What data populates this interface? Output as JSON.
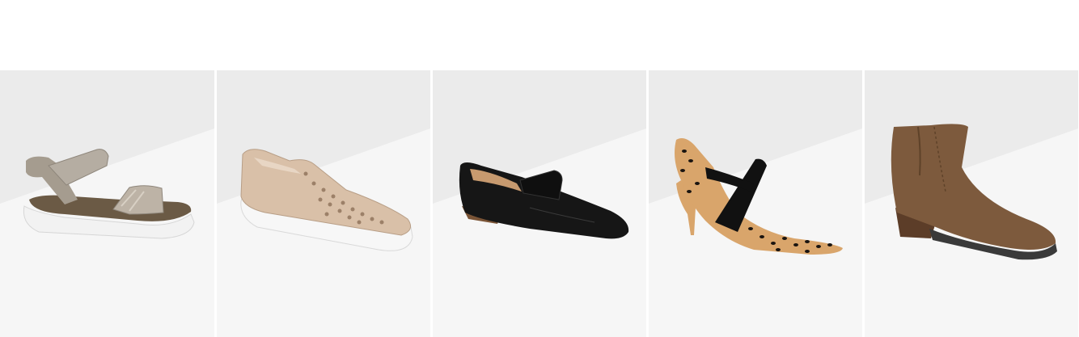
{
  "products": [
    {
      "name": "sandal-icon",
      "colors": {
        "upper": "#a59c8f",
        "sole": "#f2f2f2",
        "bed": "#6b5a45"
      }
    },
    {
      "name": "slip-on-sneaker-icon",
      "colors": {
        "upper": "#d9c0a8",
        "sole": "#f7f7f7"
      }
    },
    {
      "name": "loafer-icon",
      "colors": {
        "upper": "#161616",
        "sole": "#7a5436"
      }
    },
    {
      "name": "leopard-pump-icon",
      "colors": {
        "upper": "#d9a56b",
        "spots": "#1a1410",
        "strap": "#111111"
      }
    },
    {
      "name": "ankle-bootie-icon",
      "colors": {
        "upper": "#7d5a3d",
        "heel": "#5c3d28",
        "sole": "#3a3a3a"
      }
    }
  ]
}
